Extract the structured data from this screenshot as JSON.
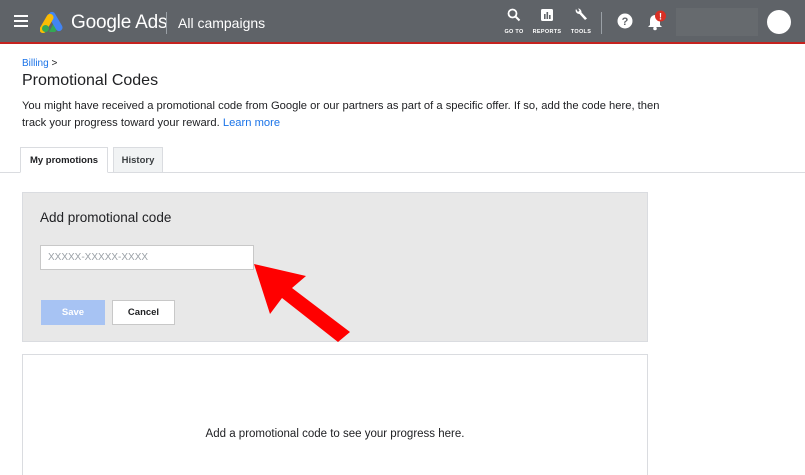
{
  "header": {
    "brand": "Google Ads",
    "campaign_title": "All campaigns",
    "tools": [
      {
        "label": "GO TO",
        "icon": "search-icon"
      },
      {
        "label": "REPORTS",
        "icon": "reports-icon"
      },
      {
        "label": "TOOLS",
        "icon": "wrench-icon"
      }
    ],
    "notification_badge": "!",
    "colors": {
      "bar": "#5f6368",
      "accent_border": "#c5221f",
      "badge": "#d93025"
    }
  },
  "breadcrumb": {
    "parent": "Billing",
    "separator": ">"
  },
  "page": {
    "title": "Promotional Codes",
    "description": "You might have received a promotional code from Google or our partners as part of a specific offer. If so, add the code here, then track your progress toward your reward.",
    "learn_more": "Learn more"
  },
  "tabs": [
    {
      "label": "My promotions",
      "active": true
    },
    {
      "label": "History",
      "active": false
    }
  ],
  "promo_form": {
    "title": "Add promotional code",
    "input_value": "",
    "input_placeholder": "XXXXX-XXXXX-XXXX",
    "save_label": "Save",
    "cancel_label": "Cancel",
    "save_color": "#a7c3f3"
  },
  "progress": {
    "message": "Add a promotional code to see your progress here."
  },
  "annotation": {
    "arrow_color": "#ff0000"
  }
}
